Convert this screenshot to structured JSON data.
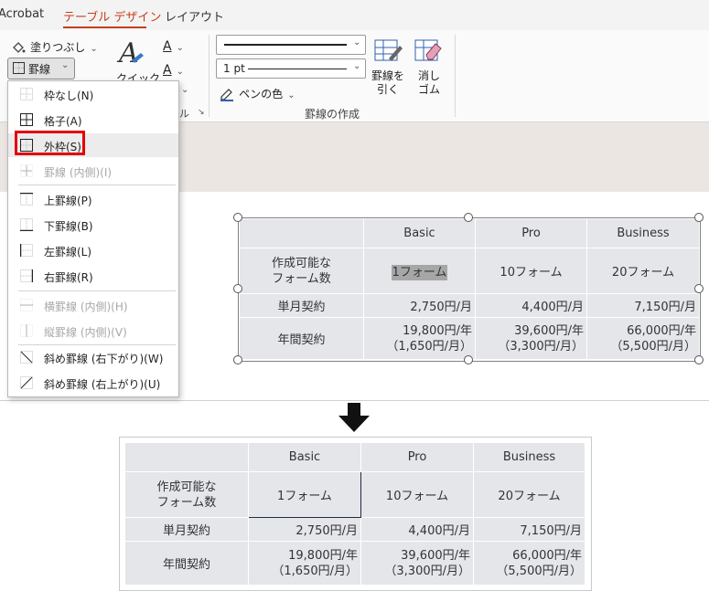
{
  "ribbon": {
    "tabs": [
      {
        "label": "Acrobat",
        "active": false
      },
      {
        "label": "テーブル デザイン",
        "active": true
      },
      {
        "label": "レイアウト",
        "active": false
      }
    ],
    "shading_label": "塗りつぶし",
    "borders_label": "罫線",
    "quick_style_label": "クイック",
    "pen_weight": "1 pt",
    "pen_color_label": "ペンの色",
    "draw_table_label_line1": "罫線を",
    "draw_table_label_line2": "引く",
    "eraser_label_line1": "消し",
    "eraser_label_line2": "ゴム",
    "group_label": "罫線の作成",
    "group_partial": "ル"
  },
  "border_menu": {
    "items": [
      {
        "label": "枠なし(N)",
        "icon": "no-border-icon",
        "enabled": true
      },
      {
        "label": "格子(A)",
        "icon": "all-borders-icon",
        "enabled": true
      },
      {
        "label": "外枠(S)",
        "icon": "outside-borders-icon",
        "enabled": true,
        "highlighted": true
      },
      {
        "label": "罫線 (内側)(I)",
        "icon": "inside-borders-icon",
        "enabled": false
      },
      {
        "label": "上罫線(P)",
        "icon": "top-border-icon",
        "enabled": true
      },
      {
        "label": "下罫線(B)",
        "icon": "bottom-border-icon",
        "enabled": true
      },
      {
        "label": "左罫線(L)",
        "icon": "left-border-icon",
        "enabled": true
      },
      {
        "label": "右罫線(R)",
        "icon": "right-border-icon",
        "enabled": true
      },
      {
        "label": "横罫線 (内側)(H)",
        "icon": "inside-horizontal-icon",
        "enabled": false
      },
      {
        "label": "縦罫線 (内側)(V)",
        "icon": "inside-vertical-icon",
        "enabled": false
      },
      {
        "label": "斜め罫線 (右下がり)(W)",
        "icon": "diagonal-down-icon",
        "enabled": true
      },
      {
        "label": "斜め罫線 (右上がり)(U)",
        "icon": "diagonal-up-icon",
        "enabled": true
      }
    ]
  },
  "table_top": {
    "headers": [
      "",
      "Basic",
      "Pro",
      "Business"
    ],
    "rows": [
      [
        "作成可能な\nフォーム数",
        "1フォーム",
        "10フォーム",
        "20フォーム"
      ],
      [
        "単月契約",
        "2,750円/月",
        "4,400円/月",
        "7,150円/月"
      ],
      [
        "年間契約",
        "19,800円/年\n（1,650円/月）",
        "39,600円/年\n（3,300円/月）",
        "66,000円/年\n（5,500円/月）"
      ]
    ]
  },
  "table_bottom": {
    "headers": [
      "",
      "Basic",
      "Pro",
      "Business"
    ],
    "rows": [
      [
        "作成可能な\nフォーム数",
        "1フォーム",
        "10フォーム",
        "20フォーム"
      ],
      [
        "単月契約",
        "2,750円/月",
        "4,400円/月",
        "7,150円/月"
      ],
      [
        "年間契約",
        "19,800円/年\n（1,650円/月）",
        "39,600円/年\n（3,300円/月）",
        "66,000円/年\n（5,500円/月）"
      ]
    ]
  },
  "colors": {
    "accent": "#c43e1c",
    "callout": "#e20000",
    "cell": "#e5e6ea"
  }
}
